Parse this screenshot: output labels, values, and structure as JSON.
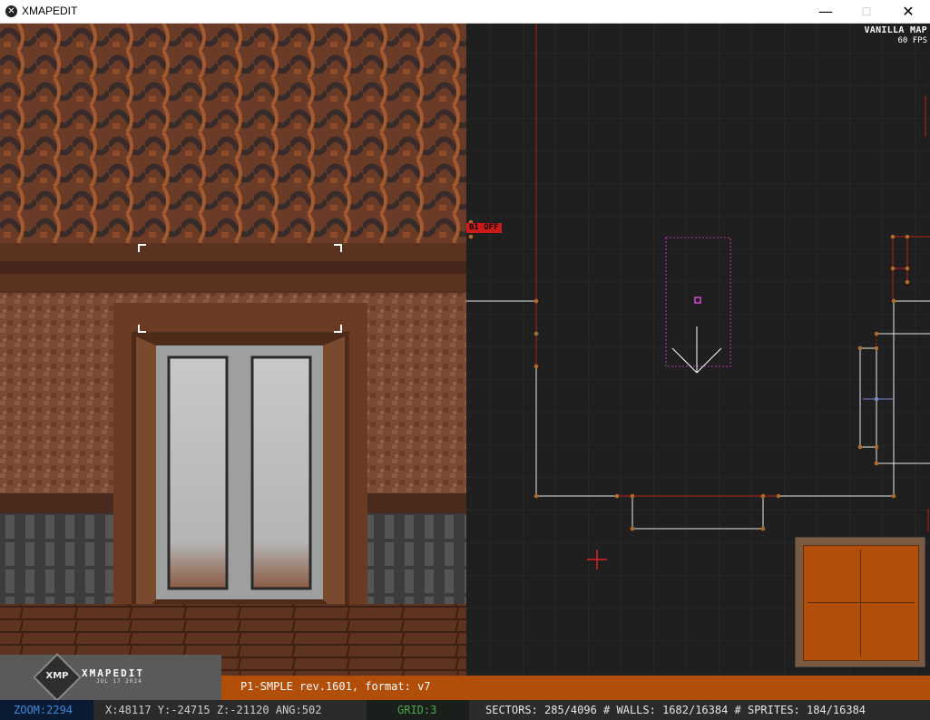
{
  "window": {
    "title": "XMAPEDIT",
    "app_icon": "x-logo-icon",
    "controls": {
      "minimize": "—",
      "maximize": "☐",
      "close": "✕"
    }
  },
  "map_view": {
    "mode_label": "VANILLA MAP",
    "fps_label": "60 FPS",
    "marker_label": "01 OFF",
    "cursor_icon": "crosshair-icon",
    "colors": {
      "background": "#1f1f1f",
      "grid": "#2c2c2c",
      "white_wall": "#ffffff",
      "red_wall": "#b5221d",
      "vertex": "#b06a2c",
      "sprite": "#c044c0"
    }
  },
  "branding": {
    "logo_text": "XMP",
    "name": "XMAPEDIT",
    "date": "JUL 17 2024"
  },
  "map_info": {
    "text": "P1-SMPLE rev.1601, format: v7"
  },
  "status": {
    "zoom": "ZOOM:2294",
    "coords": "X:48117  Y:-24715 Z:-21120 ANG:502",
    "grid": "GRID:3",
    "counts": "SECTORS: 285/4096 # WALLS: 1682/16384 # SPRITES: 184/16384"
  }
}
